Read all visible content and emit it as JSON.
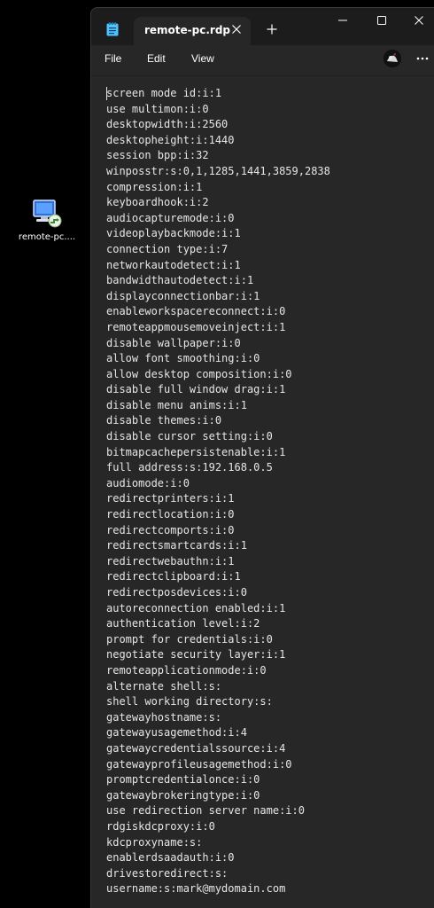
{
  "desktop": {
    "icon_label": "remote-pc...."
  },
  "window": {
    "tab_title": "remote-pc.rdp",
    "menu": {
      "file": "File",
      "edit": "Edit",
      "view": "View"
    }
  },
  "icons": {
    "app": "notepad-icon",
    "tab_close": "close-icon",
    "new_tab": "plus-icon",
    "minimize": "minimize-icon",
    "maximize": "maximize-icon",
    "close": "close-icon",
    "more": "more-icon",
    "desktop_file": "rdp-file-icon"
  },
  "colors": {
    "title_bar": "#1c1c1c",
    "editor_bg": "#272727",
    "text": "#e6e6e6",
    "app_icon": "#4cc2ff"
  },
  "document": {
    "lines": [
      "screen mode id:i:1",
      "use multimon:i:0",
      "desktopwidth:i:2560",
      "desktopheight:i:1440",
      "session bpp:i:32",
      "winposstr:s:0,1,1285,1441,3859,2838",
      "compression:i:1",
      "keyboardhook:i:2",
      "audiocapturemode:i:0",
      "videoplaybackmode:i:1",
      "connection type:i:7",
      "networkautodetect:i:1",
      "bandwidthautodetect:i:1",
      "displayconnectionbar:i:1",
      "enableworkspacereconnect:i:0",
      "remoteappmousemoveinject:i:1",
      "disable wallpaper:i:0",
      "allow font smoothing:i:0",
      "allow desktop composition:i:0",
      "disable full window drag:i:1",
      "disable menu anims:i:1",
      "disable themes:i:0",
      "disable cursor setting:i:0",
      "bitmapcachepersistenable:i:1",
      "full address:s:192.168.0.5",
      "audiomode:i:0",
      "redirectprinters:i:1",
      "redirectlocation:i:0",
      "redirectcomports:i:0",
      "redirectsmartcards:i:1",
      "redirectwebauthn:i:1",
      "redirectclipboard:i:1",
      "redirectposdevices:i:0",
      "autoreconnection enabled:i:1",
      "authentication level:i:2",
      "prompt for credentials:i:0",
      "negotiate security layer:i:1",
      "remoteapplicationmode:i:0",
      "alternate shell:s:",
      "shell working directory:s:",
      "gatewayhostname:s:",
      "gatewayusagemethod:i:4",
      "gatewaycredentialssource:i:4",
      "gatewayprofileusagemethod:i:0",
      "promptcredentialonce:i:0",
      "gatewaybrokeringtype:i:0",
      "use redirection server name:i:0",
      "rdgiskdcproxy:i:0",
      "kdcproxyname:s:",
      "enablerdsaadauth:i:0",
      "drivestoredirect:s:",
      "username:s:mark@mydomain.com"
    ]
  }
}
